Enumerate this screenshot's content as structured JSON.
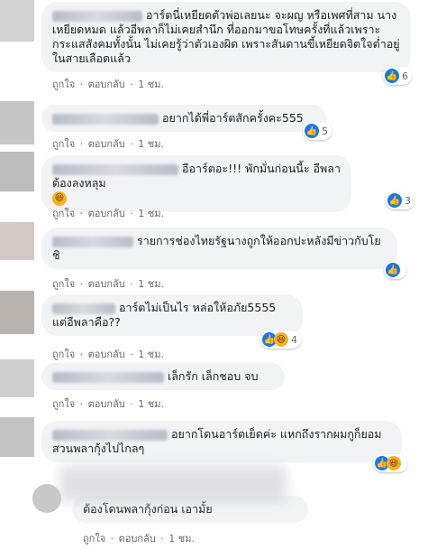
{
  "actions": {
    "like": "ถูกใจ",
    "reply": "ตอบกลับ",
    "sep": " · ",
    "time": "1 ชม."
  },
  "comments": [
    {
      "text": "อาร์ตนี่เหยียดตัวพ่อเลยนะ จะผญ หรือเพศที่สาม นางเหยียดหมด แล้วอีพลาก็ไม่เคยสำนึก ที่ออกมาขอโทษครั้งที่แล้วเพราะกระแสสังคมทั้งนั้น ไม่เคยรู้ว่าตัวเองผิด เพราะสันดานขี้เหยียดจิตใจต่ำอยู่ในสายเลือดแล้ว",
      "reaction_count": "6"
    },
    {
      "text": "อยากได้พี่อาร์ตสักครั้งคะ555",
      "reaction_count": "5"
    },
    {
      "text": "อีอาร์ตอะ!!! พักมั่นก่อนนี้ะ อีพลาต้องลงหลุม",
      "reaction_count": "3"
    },
    {
      "text": "รายการช่องไทยรัฐนางถูกให้ออกปะหลังมีข่าวกับโยชิ",
      "reaction_count": ""
    },
    {
      "text": "อาร์ตไม่เป็นไร หล่อให้อภัย5555 แต่อีพลาคือ??",
      "reaction_count": "4"
    },
    {
      "text": "เล็กรัก เล็กชอบ จบ",
      "reaction_count": ""
    },
    {
      "text": "อยากโดนอาร์ตเย็ดค่ะ แหกถึงรากผมกูก็ยอม สวนพลากุ้งไปไกลๆ",
      "reaction_count": ""
    },
    {
      "text": "ต้องโดนพลากุ้งก่อน เอามั้ย",
      "reaction_count": ""
    }
  ]
}
